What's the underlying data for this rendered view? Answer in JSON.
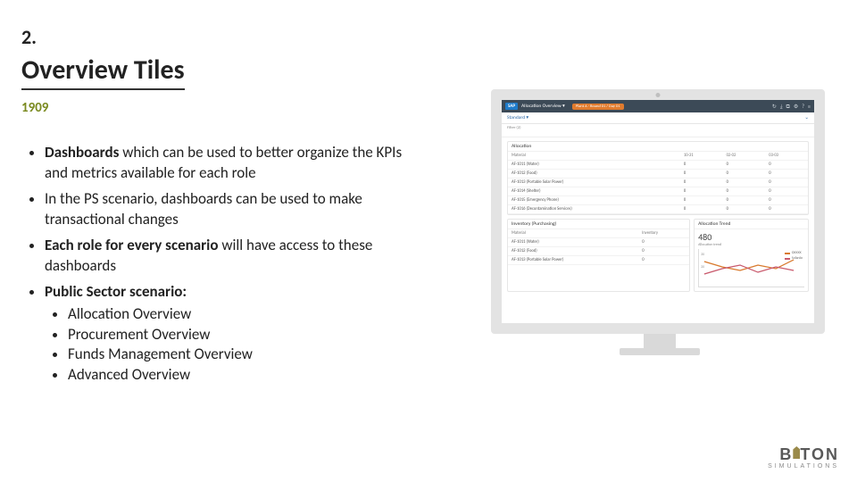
{
  "slide": {
    "number": "2.",
    "title": "Overview Tiles",
    "tag": "1909"
  },
  "bullets": {
    "b1_bold": "Dashboards",
    "b1_rest": " which can be used to better organize the KPIs and metrics available for each role",
    "b2": "In the PS scenario, dashboards can be used to make transactional changes",
    "b3_bold": "Each role for every scenario",
    "b3_rest": " will have access to these dashboards",
    "b4_bold": "Public Sector scenario:",
    "b4_items": {
      "i1": "Allocation Overview",
      "i2": "Procurement Overview",
      "i3": "Funds Management Overview",
      "i4": "Advanced Overview"
    }
  },
  "sap": {
    "logo": "SAP",
    "app_title": "Allocation Overview ▾",
    "pill": "Plant A · Round 01 / Day 01",
    "icons": {
      "i1": "↻",
      "i2": "⤓",
      "i3": "⧉",
      "i4": "⚙",
      "i5": "?",
      "i6": "≡"
    },
    "standard_label": "Standard ▾",
    "filter_label": "Filter (2)",
    "go_icon": "⌄"
  },
  "allocation": {
    "title": "Allocation",
    "cols": {
      "c0": "Material",
      "c1": "10-31",
      "c2": "02-02",
      "c3": "03-03"
    },
    "rows": [
      {
        "name": "AF-1011 (Water)",
        "v1": "0",
        "v2": "0",
        "v3": "0"
      },
      {
        "name": "AF-1012 (Food)",
        "v1": "0",
        "v2": "0",
        "v3": "0"
      },
      {
        "name": "AF-1013 (Portable Solar Power)",
        "v1": "0",
        "v2": "0",
        "v3": "0"
      },
      {
        "name": "AF-1014 (Shelter)",
        "v1": "0",
        "v2": "0",
        "v3": "0"
      },
      {
        "name": "AF-1015 (Emergency Phone)",
        "v1": "0",
        "v2": "0",
        "v3": "0"
      },
      {
        "name": "AF-1016 (Decontamination Services)",
        "v1": "0",
        "v2": "0",
        "v3": "0"
      }
    ]
  },
  "inventory": {
    "title": "Inventory (Purchasing)",
    "cols": {
      "c0": "Material",
      "c1": "Inventory"
    },
    "rows": [
      {
        "name": "AF-1011 (Water)",
        "v": "0"
      },
      {
        "name": "AF-1012 (Food)",
        "v": "0"
      },
      {
        "name": "AF-1013 (Portable Solar Power)",
        "v": "0"
      }
    ]
  },
  "trend": {
    "title": "Allocation Trend",
    "value": "480",
    "subtitle": "Allocation trend",
    "legend": {
      "l1": "OXXXX",
      "l2": "SolarAx"
    },
    "yticks": {
      "t1": "30",
      "t2": "20"
    }
  },
  "chart_data": {
    "type": "line",
    "title": "Allocation Trend",
    "ylim": [
      0,
      40
    ],
    "series": [
      {
        "name": "OXXXX",
        "color": "#d97a2e",
        "values": [
          28,
          22,
          18,
          24,
          20,
          30
        ]
      },
      {
        "name": "SolarAx",
        "color": "#c95a6d",
        "values": [
          14,
          20,
          24,
          16,
          22,
          18
        ]
      }
    ]
  },
  "brand": {
    "name_pre": "B",
    "name_post": "TON",
    "sub": "SIMULATIONS"
  }
}
